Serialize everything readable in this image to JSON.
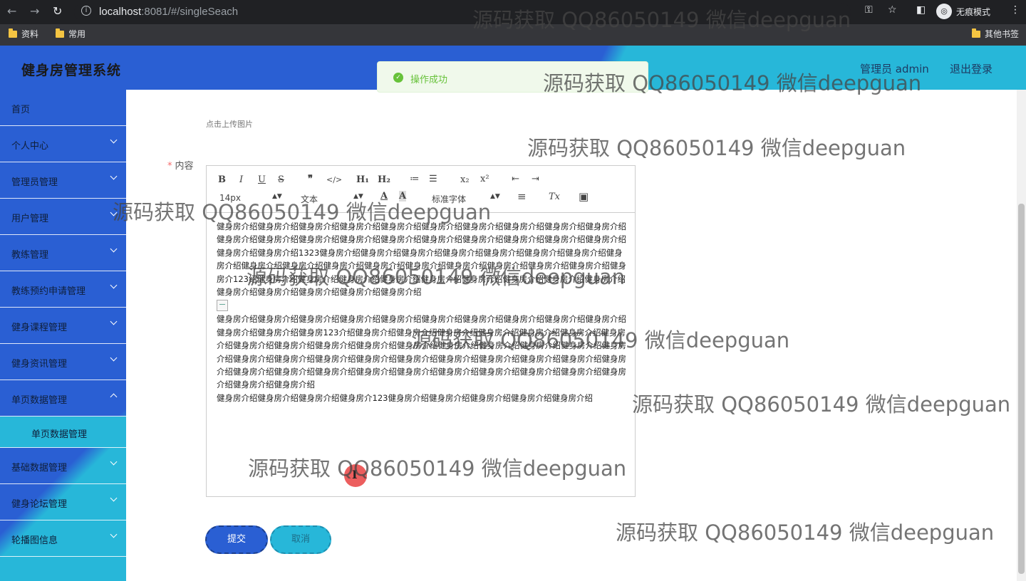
{
  "browser": {
    "url_host": "localhost",
    "url_rest": ":8081/#/singleSeach",
    "incognito_label": "无痕模式",
    "bookmarks": [
      "资料",
      "常用"
    ],
    "other_bookmarks": "其他书签"
  },
  "header": {
    "title": "健身房管理系统",
    "user": "管理员 admin",
    "logout": "退出登录"
  },
  "sidebar": {
    "items": [
      {
        "label": "首页",
        "has_arrow": false
      },
      {
        "label": "个人中心",
        "has_arrow": true
      },
      {
        "label": "管理员管理",
        "has_arrow": true
      },
      {
        "label": "用户管理",
        "has_arrow": true
      },
      {
        "label": "教练管理",
        "has_arrow": true
      },
      {
        "label": "教练预约申请管理",
        "has_arrow": true
      },
      {
        "label": "健身课程管理",
        "has_arrow": true
      },
      {
        "label": "健身资讯管理",
        "has_arrow": true
      },
      {
        "label": "单页数据管理",
        "has_arrow": true
      }
    ],
    "submenu": "单页数据管理",
    "items_after": [
      {
        "label": "基础数据管理"
      },
      {
        "label": "健身论坛管理"
      },
      {
        "label": "轮播图信息"
      }
    ]
  },
  "form": {
    "upload_hint": "点击上传图片",
    "content_label": "内容",
    "required_mark": "*",
    "submit": "提交",
    "cancel": "取消"
  },
  "editor": {
    "toolbar": {
      "bold": "B",
      "italic": "I",
      "underline": "U",
      "strike": "S",
      "quote": "❞",
      "code": "</>",
      "h1": "H₁",
      "h2": "H₂",
      "ordered": "≔",
      "bullet": "☰",
      "sub": "x₂",
      "sup": "x²",
      "outdent": "⇤",
      "indent": "⇥",
      "size": "14px",
      "style": "文本",
      "color": "A",
      "bg": "A",
      "font": "标准字体",
      "align": "≡",
      "clean": "Tx",
      "image": "▣"
    },
    "paragraph1": "健身房介绍健身房介绍健身房介绍健身房介绍健身房介绍健身房介绍健身房介绍健身房介绍健身房介绍健身房介绍健身房介绍健身房介绍健身房介绍健身房介绍健身房介绍健身房介绍健身房介绍健身房介绍健身房介绍健身房介绍健身房介绍健身房介绍1323健身房介绍健身房介绍健身房介绍健身房介绍健身房介绍健身房介绍健身房介绍健身房介绍健身房介绍健身房介绍健身房介绍健身房介绍健身房介绍健身房介绍健身房介绍健身房介绍健身房介绍健身房介123绍健身房介绍健身房介绍健身房介绍健身房介绍健身房介绍健身房介绍健身房介绍健身房介绍健身房介绍健身房介绍健身房介绍健身房介绍健身房介绍健身房介绍",
    "paragraph2": "健身房介绍健身房介绍健身房介绍健身房介绍健身房介绍健身房介绍健身房介绍健身房介绍健身房介绍健身房介绍健身房介绍健身房介绍健身房123介绍健身房介绍健身房介绍健身房介绍健身房介绍健身房介绍健身房介绍健身房介绍健身房介绍健身房介绍健身房介绍健身房介绍健身房介绍健身房介绍健身房介绍健身房介绍健身房介绍健身房介绍健身房介绍健身房介绍健身房介绍健身房介绍健身房介绍健身房介绍健身房介绍健身房介绍健身房介绍健身房介绍健身房介绍健身房介绍健身房介绍健身房介绍健身房介绍健身房介绍健身房介绍健身房介绍健身房介绍健身房介绍健身房介绍健身房介绍",
    "paragraph3": "健身房介绍健身房介绍健身房介绍健身房介123健身房介绍健身房介绍健身房介绍健身房介绍健身房介绍"
  },
  "message": {
    "text": "操作成功"
  },
  "watermark": "源码获取 QQ86050149 微信deepguan",
  "colors": {
    "primary": "#2a5fd3",
    "accent": "#27b7d9",
    "success": "#67c23a"
  }
}
